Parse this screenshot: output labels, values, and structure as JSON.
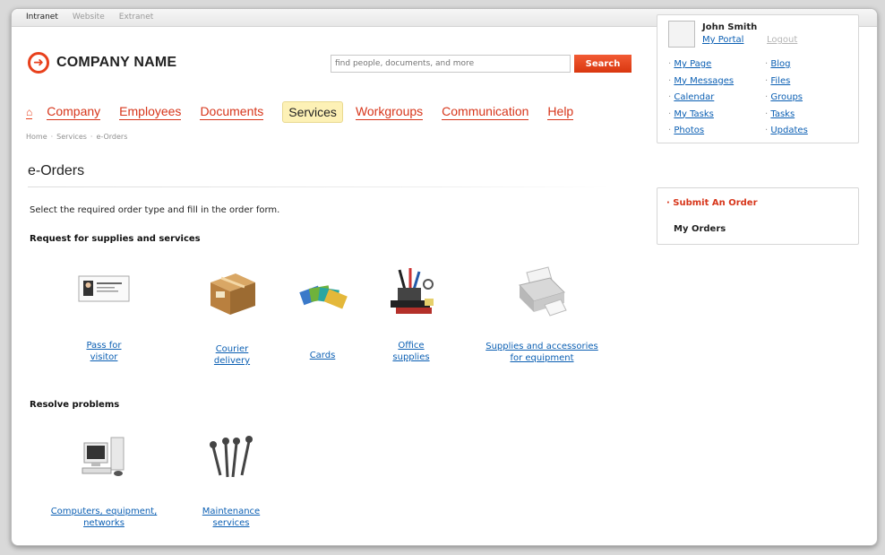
{
  "top_tabs": [
    "Intranet",
    "Website",
    "Extranet"
  ],
  "logo": {
    "name": "COMPANY NAME"
  },
  "search": {
    "placeholder": "find people, documents, and more",
    "button": "Search"
  },
  "nav": {
    "items": [
      "Company",
      "Employees",
      "Documents",
      "Services",
      "Workgroups",
      "Communication",
      "Help"
    ],
    "active": "Services"
  },
  "breadcrumb": [
    "Home",
    "Services",
    "e-Orders"
  ],
  "page": {
    "title": "e-Orders",
    "intro": "Select the required order type and fill in the order form."
  },
  "sections": [
    {
      "title": "Request for supplies and services",
      "items": [
        {
          "line1": "Pass for",
          "line2": "visitor",
          "icon": "id-card-icon"
        },
        {
          "line1": "Courier",
          "line2": "delivery",
          "icon": "package-icon"
        },
        {
          "line1": "Cards",
          "line2": "",
          "icon": "cards-icon"
        },
        {
          "line1": "Office",
          "line2": "supplies",
          "icon": "office-supplies-icon"
        },
        {
          "line1": "Supplies and accessories",
          "line2": "for equipment",
          "icon": "printer-icon"
        }
      ]
    },
    {
      "title": "Resolve problems",
      "items": [
        {
          "line1": "Computers, equipment,",
          "line2": "networks",
          "icon": "computer-icon"
        },
        {
          "line1": "Maintenance",
          "line2": "services",
          "icon": "wrench-icon"
        }
      ]
    }
  ],
  "user": {
    "name": "John Smith",
    "portal": "My Portal",
    "logout": "Logout",
    "links_left": [
      "My Page",
      "My Messages",
      "Calendar",
      "My Tasks",
      "Photos"
    ],
    "links_right": [
      "Blog",
      "Files",
      "Groups",
      "Tasks",
      "Updates"
    ]
  },
  "orders_panel": {
    "active": "Submit An Order",
    "item": "My Orders"
  },
  "colors": {
    "accent": "#e8401c",
    "link": "#0b5fb3",
    "active_tab": "#fdf1b6"
  }
}
